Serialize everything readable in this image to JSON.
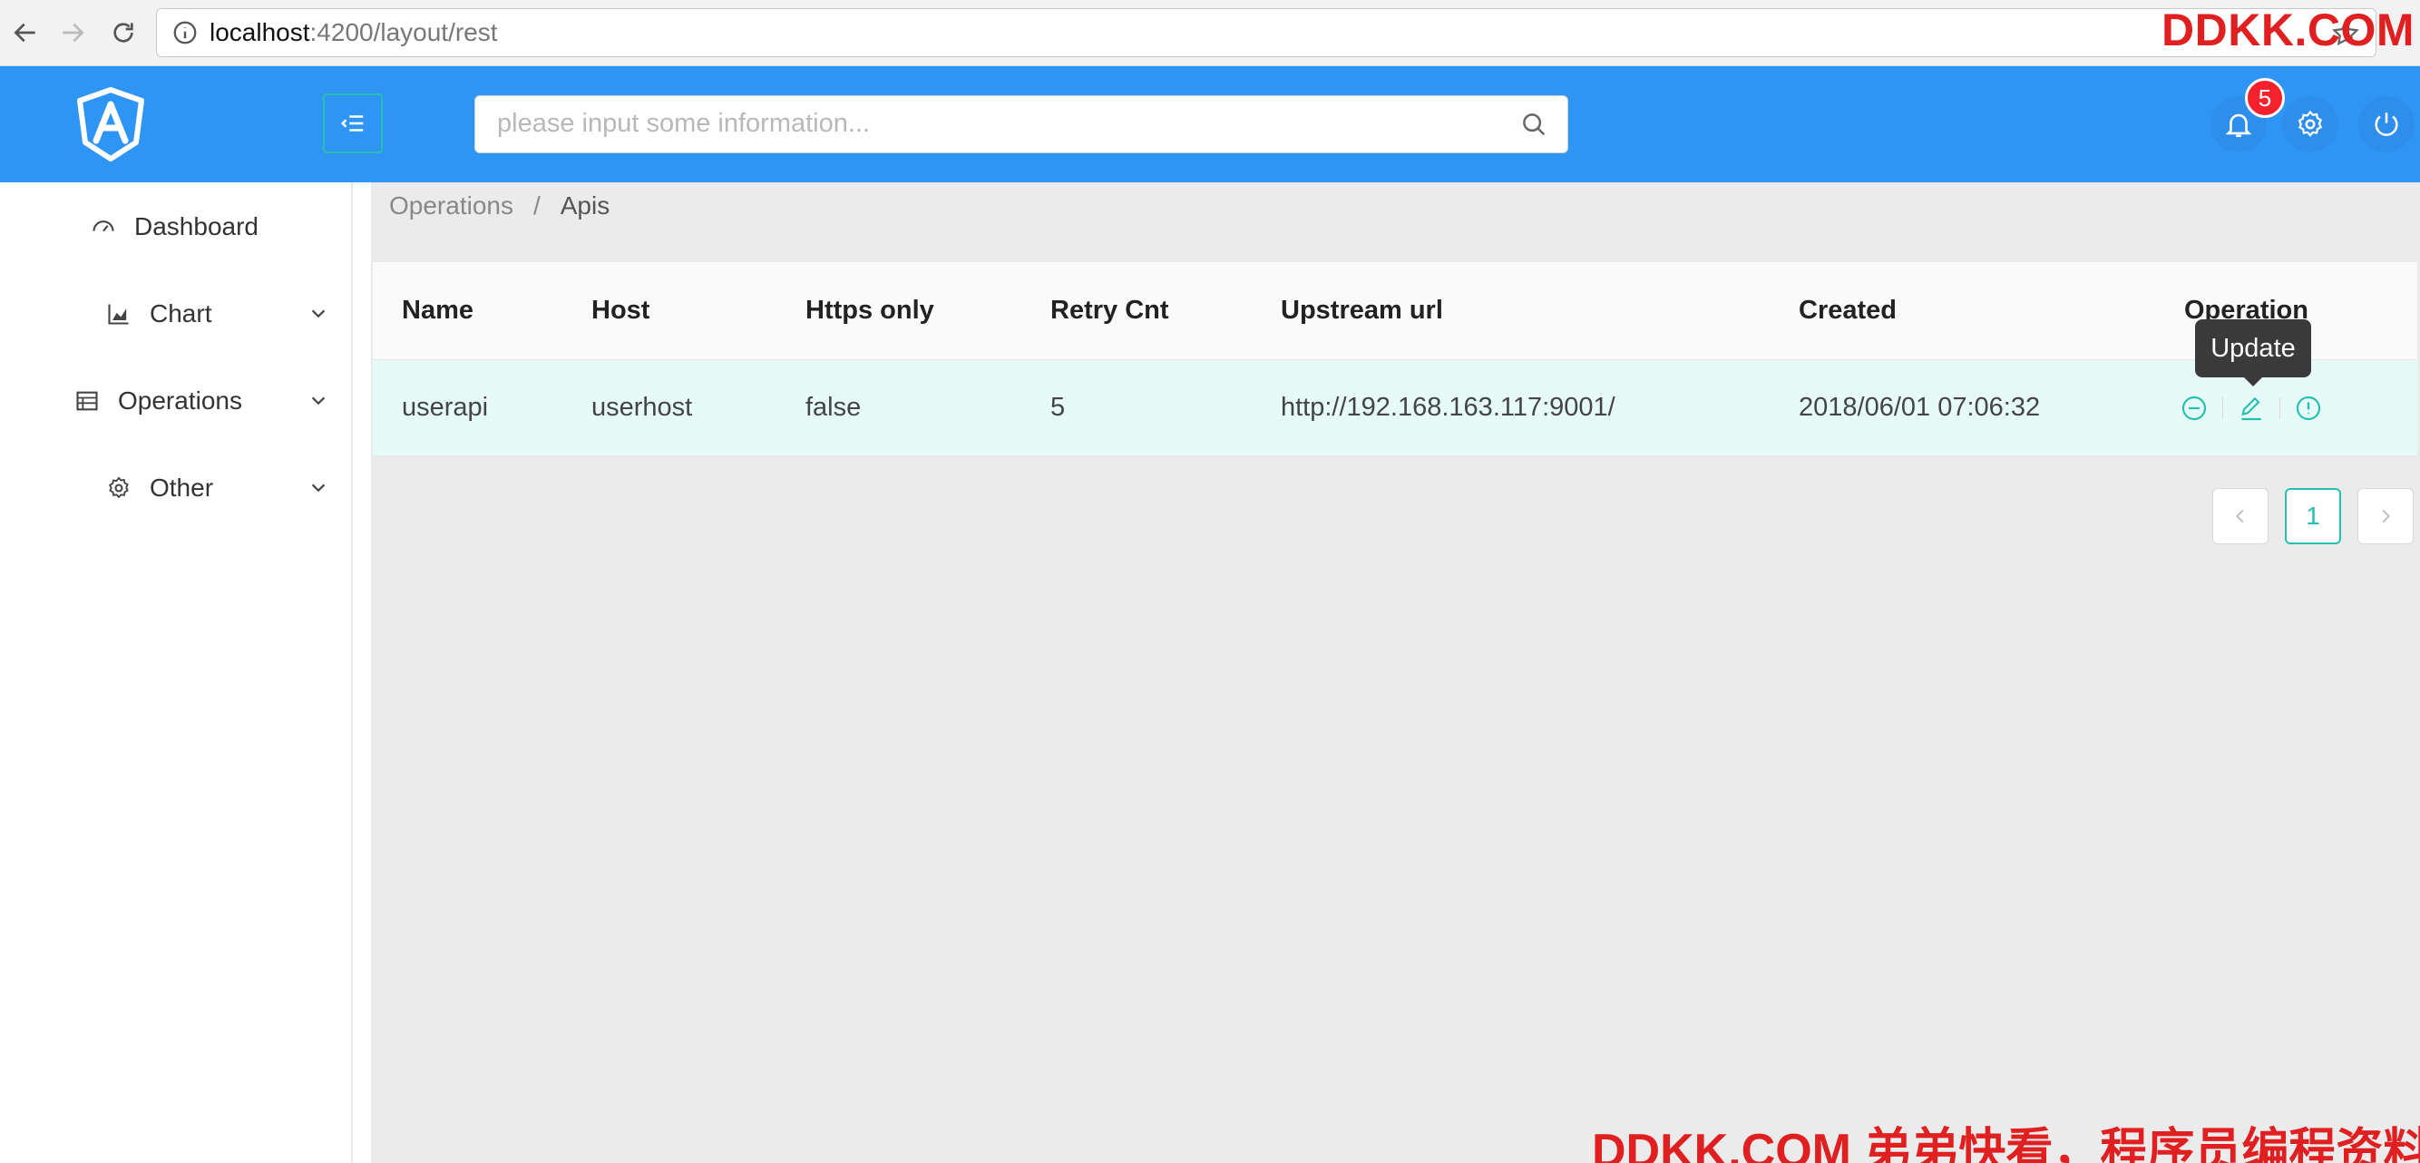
{
  "browser": {
    "url_host": "localhost",
    "url_path": ":4200/layout/rest"
  },
  "watermark": {
    "top": "DDKK.COM",
    "bottom": "DDKK.COM 弟弟快看，程序员编程资料站"
  },
  "header": {
    "search_placeholder": "please input some information...",
    "notification_count": "5",
    "accent": "#2f95f5",
    "primary": "#27bfb1"
  },
  "sidebar": {
    "items": [
      {
        "label": "Dashboard",
        "icon": "dashboard-icon"
      },
      {
        "label": "Chart",
        "icon": "area-chart-icon"
      },
      {
        "label": "Operations",
        "icon": "table-icon"
      },
      {
        "label": "Other",
        "icon": "gear-icon"
      }
    ]
  },
  "breadcrumb": {
    "parent": "Operations",
    "separator": "/",
    "current": "Apis"
  },
  "table": {
    "columns": [
      "Name",
      "Host",
      "Https only",
      "Retry Cnt",
      "Upstream url",
      "Created",
      "Operation"
    ],
    "rows": [
      {
        "name": "userapi",
        "host": "userhost",
        "https_only": "false",
        "retry_cnt": "5",
        "upstream_url": "http://192.168.163.117:9001/",
        "created": "2018/06/01 07:06:32"
      }
    ]
  },
  "tooltip": {
    "label": "Update"
  },
  "pagination": {
    "current": "1"
  }
}
